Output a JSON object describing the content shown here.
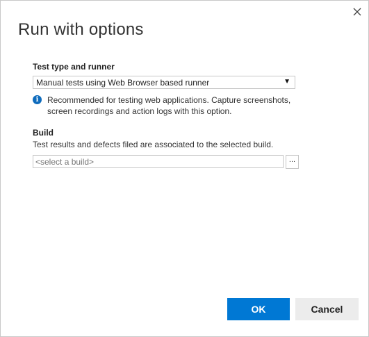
{
  "dialog": {
    "title": "Run with options",
    "close_icon": "close-icon"
  },
  "test_runner": {
    "label": "Test type and runner",
    "selected": "Manual tests using Web Browser based runner",
    "caret": "▼",
    "info_icon": "info-icon",
    "info_glyph": "i",
    "info_text": "Recommended for testing web applications. Capture screenshots, screen recordings and action logs with this option."
  },
  "build": {
    "label": "Build",
    "description": "Test results and defects filed are associated to the selected build.",
    "placeholder": "<select a build>",
    "browse_label": "..."
  },
  "footer": {
    "ok_label": "OK",
    "cancel_label": "Cancel"
  },
  "colors": {
    "accent": "#0078d4",
    "info": "#0f6cbd",
    "cancel_bg": "#ececec"
  }
}
